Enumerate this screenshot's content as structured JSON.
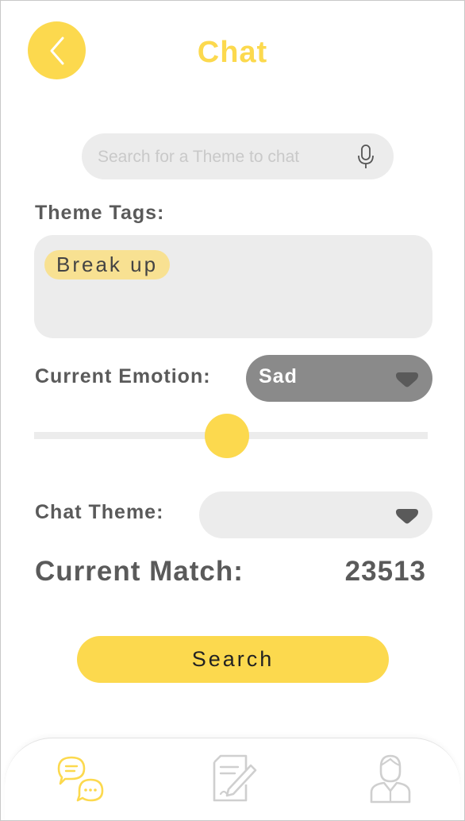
{
  "header": {
    "title": "Chat"
  },
  "search": {
    "placeholder": "Search for a Theme to chat"
  },
  "theme_tags": {
    "label": "Theme Tags:",
    "tags": [
      "Break up"
    ]
  },
  "emotion": {
    "label": "Current Emotion:",
    "selected": "Sad",
    "slider_level": 0.49
  },
  "chat_theme": {
    "label": "Chat Theme:",
    "selected": ""
  },
  "match": {
    "label": "Current Match:",
    "value": "23513"
  },
  "search_button": {
    "label": "Search"
  },
  "colors": {
    "accent": "#fcd94e",
    "tag_chip": "#f8e192",
    "field_bg": "#ececec",
    "dropdown_dark": "#8a8a8a",
    "text": "#5a5a5a"
  },
  "tabbar": {
    "items": [
      {
        "icon": "chat-bubbles-icon",
        "active": true
      },
      {
        "icon": "note-edit-icon",
        "active": false
      },
      {
        "icon": "user-profile-icon",
        "active": false
      }
    ]
  }
}
